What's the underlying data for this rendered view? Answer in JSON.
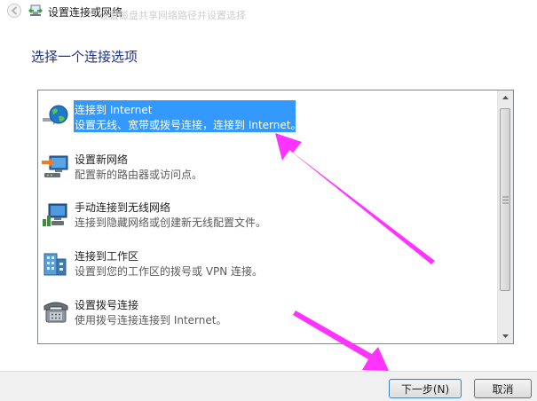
{
  "window": {
    "title": "设置连接或网络",
    "ghost_title": "设置磁盘共享网络路径并设置选择"
  },
  "heading": "选择一个连接选项",
  "options": [
    {
      "title": "连接到 Internet",
      "description": "设置无线、宽带或拨号连接，连接到 Internet。",
      "icon": "globe-network-icon",
      "selected": true
    },
    {
      "title": "设置新网络",
      "description": "配置新的路由器或访问点。",
      "icon": "router-setup-icon",
      "selected": false
    },
    {
      "title": "手动连接到无线网络",
      "description": "连接到隐藏网络或创建新无线配置文件。",
      "icon": "wireless-network-icon",
      "selected": false
    },
    {
      "title": "连接到工作区",
      "description": "设置到您的工作区的拨号或 VPN 连接。",
      "icon": "workplace-icon",
      "selected": false
    },
    {
      "title": "设置拨号连接",
      "description": "使用拨号连接连接到 Internet。",
      "icon": "telephone-icon",
      "selected": false
    }
  ],
  "buttons": {
    "next": "下一步(N)",
    "cancel": "取消"
  },
  "colors": {
    "heading": "#1e3287",
    "selection": "#3399ff",
    "annotation_arrow": "#ff33ff",
    "footer": "#f0f0f0"
  }
}
